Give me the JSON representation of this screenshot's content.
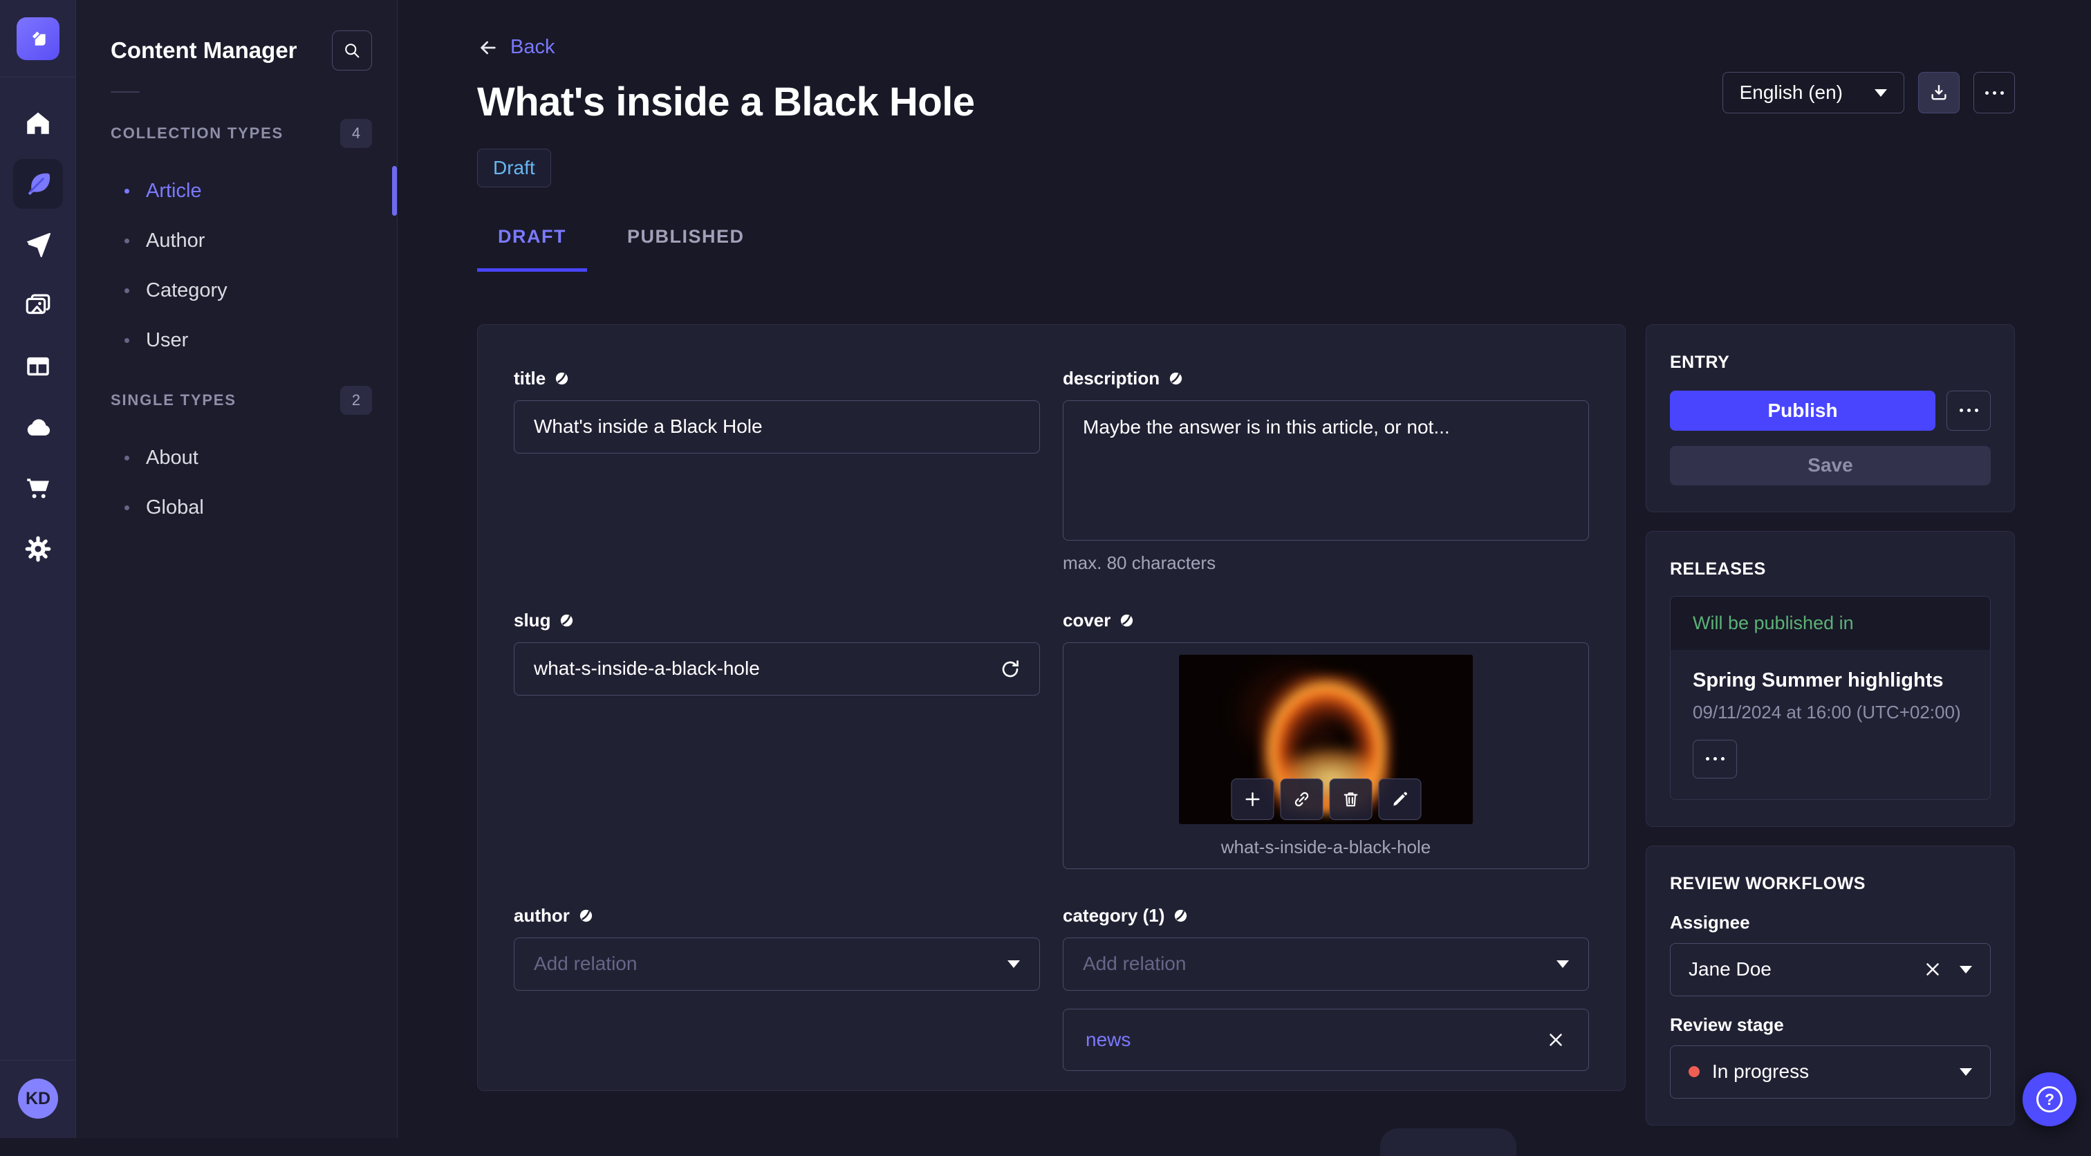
{
  "colors": {
    "accent": "#4945ff",
    "accent_light": "#7b79ff",
    "status_draft": "#66b7f1",
    "success": "#5cb176",
    "danger": "#ee5e52"
  },
  "rail": {
    "items": [
      {
        "icon": "home-icon"
      },
      {
        "icon": "content-feather-icon",
        "active": true
      },
      {
        "icon": "send-icon"
      },
      {
        "icon": "media-library-icon"
      },
      {
        "icon": "layout-icon"
      },
      {
        "icon": "cloud-icon"
      },
      {
        "icon": "cart-icon"
      },
      {
        "icon": "settings-gear-icon"
      }
    ],
    "avatar_initials": "KD"
  },
  "sidebar": {
    "title": "Content Manager",
    "sections": [
      {
        "label": "COLLECTION TYPES",
        "badge": "4",
        "items": [
          {
            "label": "Article",
            "active": true
          },
          {
            "label": "Author"
          },
          {
            "label": "Category"
          },
          {
            "label": "User"
          }
        ]
      },
      {
        "label": "SINGLE TYPES",
        "badge": "2",
        "items": [
          {
            "label": "About"
          },
          {
            "label": "Global"
          }
        ]
      }
    ]
  },
  "header": {
    "back_label": "Back",
    "title": "What's inside a Black Hole",
    "status_badge": "Draft",
    "tabs": [
      {
        "label": "DRAFT",
        "active": true
      },
      {
        "label": "PUBLISHED"
      }
    ],
    "locale_select": {
      "value": "English (en)"
    }
  },
  "form": {
    "title_field": {
      "label": "title",
      "value": "What's inside a Black Hole"
    },
    "description_field": {
      "label": "description",
      "value": "Maybe the answer is in this article, or not...",
      "hint": "max. 80 characters"
    },
    "slug_field": {
      "label": "slug",
      "value": "what-s-inside-a-black-hole"
    },
    "cover_field": {
      "label": "cover",
      "caption": "what-s-inside-a-black-hole"
    },
    "author_field": {
      "label": "author",
      "placeholder": "Add relation"
    },
    "category_field": {
      "label": "category (1)",
      "placeholder": "Add relation",
      "relation": "news"
    }
  },
  "entry_panel": {
    "title": "ENTRY",
    "publish_label": "Publish",
    "save_label": "Save"
  },
  "releases_panel": {
    "title": "RELEASES",
    "status": "Will be published in",
    "release_name": "Spring Summer highlights",
    "release_date": "09/11/2024 at 16:00 (UTC+02:00)"
  },
  "review_panel": {
    "title": "REVIEW WORKFLOWS",
    "assignee_label": "Assignee",
    "assignee_value": "Jane Doe",
    "stage_label": "Review stage",
    "stage_value": "In progress"
  }
}
